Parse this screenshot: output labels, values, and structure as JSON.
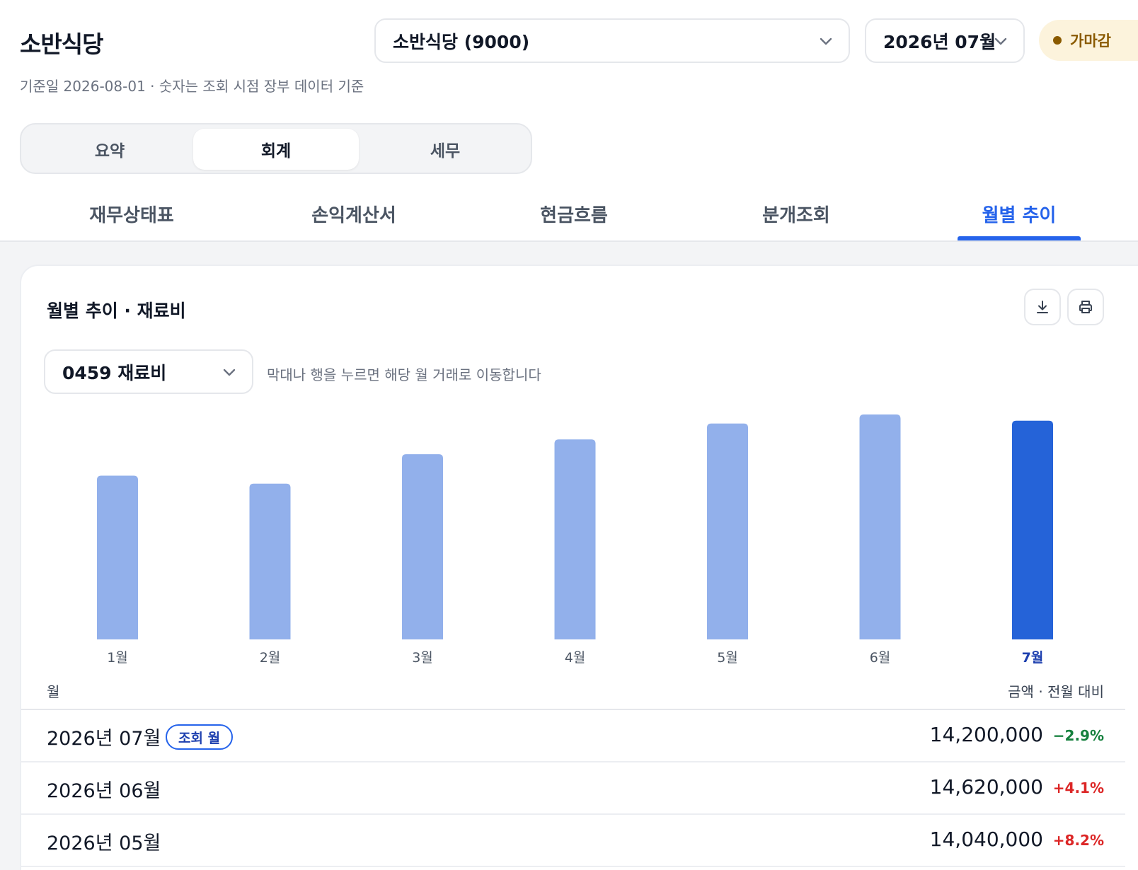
{
  "header": {
    "title": "소반식당",
    "subtitle": "기준일 2026-08-01 · 숫자는 조회 시점 장부 데이터 기준",
    "company_select": "소반식당 (9000)",
    "month_select": "2026년 07월",
    "status_badge": "가마감"
  },
  "segments": [
    {
      "label": "요약",
      "active": false
    },
    {
      "label": "회계",
      "active": true
    },
    {
      "label": "세무",
      "active": false
    }
  ],
  "tabs": [
    {
      "label": "재무상태표",
      "active": false
    },
    {
      "label": "손익계산서",
      "active": false
    },
    {
      "label": "현금흐름",
      "active": false
    },
    {
      "label": "분개조회",
      "active": false
    },
    {
      "label": "월별 추이",
      "active": true
    }
  ],
  "card": {
    "title": "월별 추이 · 재료비",
    "download_icon": "download-icon",
    "print_icon": "print-icon",
    "account_select": "0459 재료비",
    "hint": "막대나 행을 누르면 해당 월 거래로 이동합니다"
  },
  "chart_data": {
    "type": "bar",
    "categories": [
      "1월",
      "2월",
      "3월",
      "4월",
      "5월",
      "6월",
      "7월"
    ],
    "values": [
      10300000,
      9800000,
      11650000,
      12580000,
      13580000,
      14150000,
      13760000
    ],
    "highlight_index": 6,
    "ylim": [
      0,
      14150000
    ],
    "grid": false,
    "colors": {
      "bar": "#92b0eb",
      "highlight": "#2563d8",
      "label": "#4b5563",
      "highlight_label": "#1e40af"
    }
  },
  "table": {
    "col_month": "월",
    "col_amount": "금액 · 전월 대비",
    "current_badge": "조회 월",
    "rows": [
      {
        "month": "2026년 07월",
        "amount": "14,200,000",
        "change": "−2.9%",
        "dir": "down",
        "current": true
      },
      {
        "month": "2026년 06월",
        "amount": "14,620,000",
        "change": "+4.1%",
        "dir": "up",
        "current": false
      },
      {
        "month": "2026년 05월",
        "amount": "14,040,000",
        "change": "+8.2%",
        "dir": "up",
        "current": false
      }
    ]
  }
}
